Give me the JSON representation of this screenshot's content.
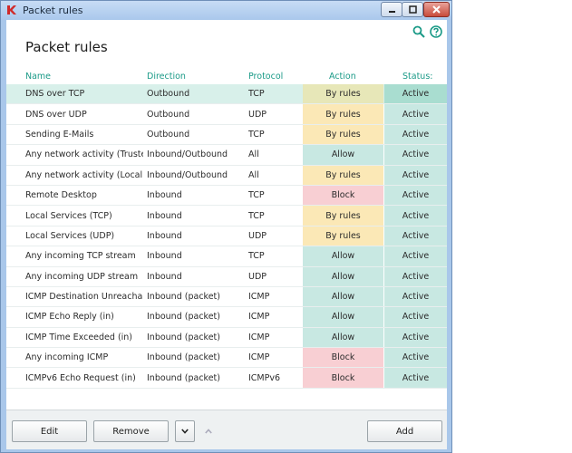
{
  "window": {
    "title": "Packet rules"
  },
  "page": {
    "title": "Packet rules"
  },
  "columns": {
    "name": "Name",
    "direction": "Direction",
    "protocol": "Protocol",
    "action": "Action",
    "status": "Status:"
  },
  "rows": [
    {
      "name": "DNS over TCP",
      "direction": "Outbound",
      "protocol": "TCP",
      "action": "By rules",
      "status": "Active",
      "action_kind": "rules",
      "selected": true
    },
    {
      "name": "DNS over UDP",
      "direction": "Outbound",
      "protocol": "UDP",
      "action": "By rules",
      "status": "Active",
      "action_kind": "rules"
    },
    {
      "name": "Sending E-Mails",
      "direction": "Outbound",
      "protocol": "TCP",
      "action": "By rules",
      "status": "Active",
      "action_kind": "rules"
    },
    {
      "name": "Any network activity (Trusted…",
      "direction": "Inbound/Outbound",
      "protocol": "All",
      "action": "Allow",
      "status": "Active",
      "action_kind": "allow"
    },
    {
      "name": "Any network activity (Local ne…",
      "direction": "Inbound/Outbound",
      "protocol": "All",
      "action": "By rules",
      "status": "Active",
      "action_kind": "rules"
    },
    {
      "name": "Remote Desktop",
      "direction": "Inbound",
      "protocol": "TCP",
      "action": "Block",
      "status": "Active",
      "action_kind": "block"
    },
    {
      "name": "Local Services (TCP)",
      "direction": "Inbound",
      "protocol": "TCP",
      "action": "By rules",
      "status": "Active",
      "action_kind": "rules"
    },
    {
      "name": "Local Services (UDP)",
      "direction": "Inbound",
      "protocol": "UDP",
      "action": "By rules",
      "status": "Active",
      "action_kind": "rules"
    },
    {
      "name": "Any incoming TCP stream",
      "direction": "Inbound",
      "protocol": "TCP",
      "action": "Allow",
      "status": "Active",
      "action_kind": "allow"
    },
    {
      "name": "Any incoming UDP stream",
      "direction": "Inbound",
      "protocol": "UDP",
      "action": "Allow",
      "status": "Active",
      "action_kind": "allow"
    },
    {
      "name": "ICMP Destination Unreachabl…",
      "direction": "Inbound (packet)",
      "protocol": "ICMP",
      "action": "Allow",
      "status": "Active",
      "action_kind": "allow"
    },
    {
      "name": "ICMP Echo Reply (in)",
      "direction": "Inbound (packet)",
      "protocol": "ICMP",
      "action": "Allow",
      "status": "Active",
      "action_kind": "allow"
    },
    {
      "name": "ICMP Time Exceeded (in)",
      "direction": "Inbound (packet)",
      "protocol": "ICMP",
      "action": "Allow",
      "status": "Active",
      "action_kind": "allow"
    },
    {
      "name": "Any incoming ICMP",
      "direction": "Inbound (packet)",
      "protocol": "ICMP",
      "action": "Block",
      "status": "Active",
      "action_kind": "block"
    },
    {
      "name": "ICMPv6 Echo Request (in)",
      "direction": "Inbound (packet)",
      "protocol": "ICMPv6",
      "action": "Block",
      "status": "Active",
      "action_kind": "block"
    }
  ],
  "buttons": {
    "edit": "Edit",
    "remove": "Remove",
    "add": "Add"
  },
  "colors": {
    "accent": "#1a9a87",
    "allow": "#c8e8e2",
    "rules": "#fbe8b6",
    "block": "#f8cfd3",
    "selected_row": "#d8f0ea"
  }
}
